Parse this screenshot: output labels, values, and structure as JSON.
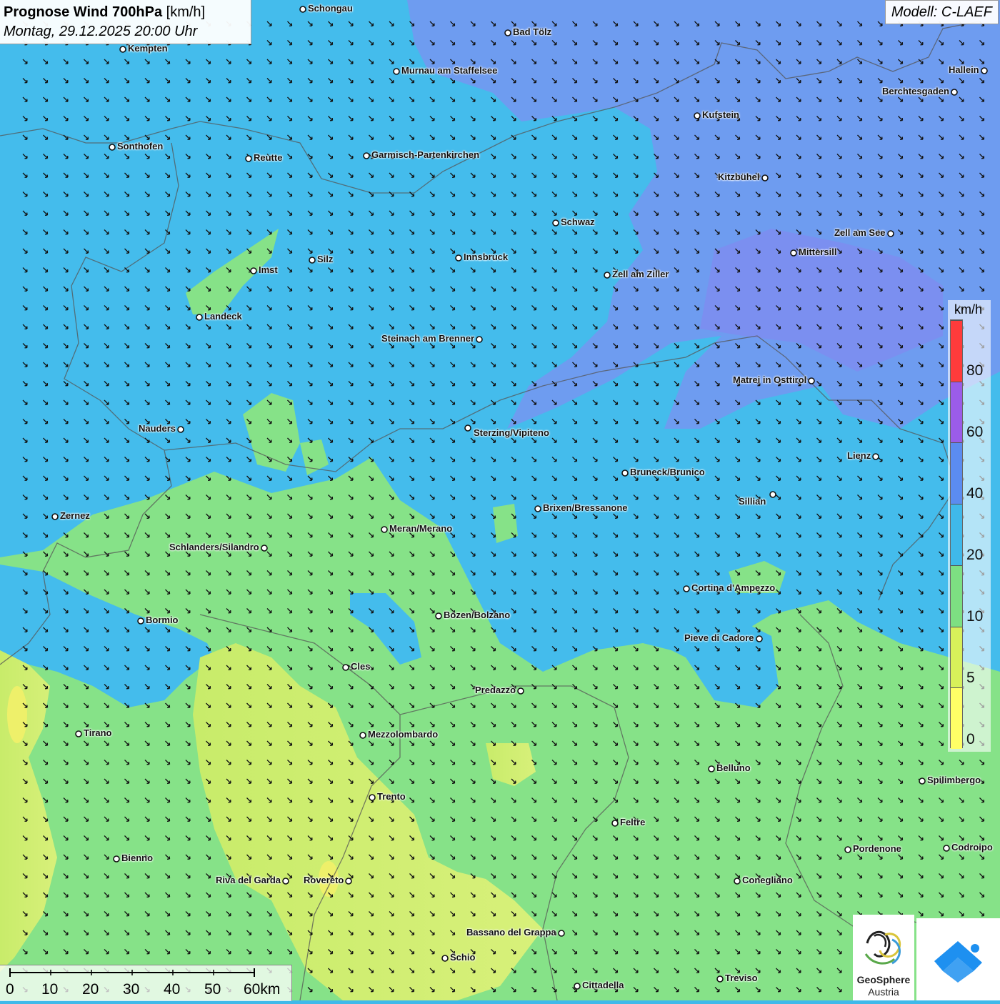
{
  "title": {
    "main_bold": "Prognose Wind 700hPa",
    "main_unit": "[km/h]",
    "datetime": "Montag, 29.12.2025 20:00 Uhr"
  },
  "model": "Modell: C-LAEF",
  "legend": {
    "unit": "km/h",
    "labels": [
      "80",
      "60",
      "40",
      "20",
      "10",
      "5",
      "0"
    ],
    "colors": [
      "#ff3b3b",
      "#9b5ce8",
      "#5b8cf0",
      "#3fb9ea",
      "#7de082",
      "#d8f05a",
      "#ffff66"
    ]
  },
  "cities": [
    {
      "name": "Schongau"
    },
    {
      "name": "Bad Tölz"
    },
    {
      "name": "Kempten"
    },
    {
      "name": "Murnau am Staffelsee"
    },
    {
      "name": "Hallein"
    },
    {
      "name": "Berchtesgaden"
    },
    {
      "name": "Kufstein"
    },
    {
      "name": "Sonthofen"
    },
    {
      "name": "Reutte"
    },
    {
      "name": "Garmisch-Partenkirchen"
    },
    {
      "name": "Kitzbühel"
    },
    {
      "name": "Schwaz"
    },
    {
      "name": "Zell am See"
    },
    {
      "name": "Mittersill"
    },
    {
      "name": "Silz"
    },
    {
      "name": "Innsbruck"
    },
    {
      "name": "Imst"
    },
    {
      "name": "Zell am Ziller"
    },
    {
      "name": "Landeck"
    },
    {
      "name": "Steinach am Brenner"
    },
    {
      "name": "Matrei in Osttirol"
    },
    {
      "name": "Nauders"
    },
    {
      "name": "Sterzing/Vipiteno"
    },
    {
      "name": "Lienz"
    },
    {
      "name": "Bruneck/Brunico"
    },
    {
      "name": "Sillian"
    },
    {
      "name": "Zernez"
    },
    {
      "name": "Brixen/Bressanone"
    },
    {
      "name": "Meran/Merano"
    },
    {
      "name": "Schlanders/Silandro"
    },
    {
      "name": "Cortina d'Ampezzo"
    },
    {
      "name": "Bozen/Bolzano"
    },
    {
      "name": "Bormio"
    },
    {
      "name": "Pieve di Cadore"
    },
    {
      "name": "Cles"
    },
    {
      "name": "Predazzo"
    },
    {
      "name": "Tirano"
    },
    {
      "name": "Mezzolombardo"
    },
    {
      "name": "Belluno"
    },
    {
      "name": "Spilimbergo"
    },
    {
      "name": "Trento"
    },
    {
      "name": "Feltre"
    },
    {
      "name": "Pordenone"
    },
    {
      "name": "Codroipo"
    },
    {
      "name": "Bienno"
    },
    {
      "name": "Riva del Garda"
    },
    {
      "name": "Rovereto"
    },
    {
      "name": "Conegliano"
    },
    {
      "name": "Bassano del Grappa"
    },
    {
      "name": "Schio"
    },
    {
      "name": "Cittadella"
    },
    {
      "name": "Treviso"
    }
  ],
  "scale": {
    "labels": [
      "0",
      "10",
      "20",
      "30",
      "40",
      "50",
      "60km"
    ]
  },
  "logo": {
    "line1": "GeoSphere",
    "line2": "Austria"
  }
}
